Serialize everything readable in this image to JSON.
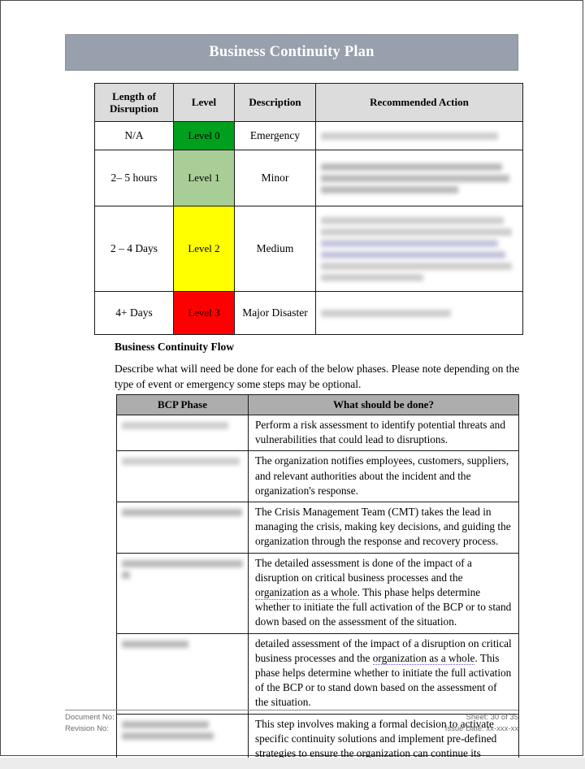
{
  "document": {
    "title": "Business Continuity Plan"
  },
  "severity_table": {
    "headers": [
      "Length of Disruption",
      "Level",
      "Description",
      "Recommended Action"
    ],
    "rows": [
      {
        "length": "N/A",
        "level": "Level 0",
        "level_color": "#00a01e",
        "description": "Emergency",
        "recommended_action": "[redacted]",
        "action_lines": 1
      },
      {
        "length": "2– 5 hours",
        "level": "Level 1",
        "level_color": "#a9cd96",
        "description": "Minor",
        "recommended_action": "[redacted]",
        "action_lines": 3
      },
      {
        "length": "2 – 4 Days",
        "level": "Level 2",
        "level_color": "#ffff00",
        "description": "Medium",
        "recommended_action": "[redacted]",
        "action_lines": 6
      },
      {
        "length": "4+ Days",
        "level": "Level 3",
        "level_color": "#fe0000",
        "description": "Major Disaster",
        "recommended_action": "[redacted]",
        "action_lines": 1
      }
    ]
  },
  "flow_section": {
    "heading": "Business Continuity Flow",
    "paragraph": "Describe what will need be done for each of the below phases. Please note depending on the type of event or emergency some steps may be optional."
  },
  "bcp_table": {
    "headers": [
      "BCP Phase",
      "What should be done?"
    ],
    "rows": [
      {
        "phase": "[redacted]",
        "what_pre": "Perform a risk assessment to identify potential threats and vulnerabilities that could lead to disruptions.",
        "what_spell": "",
        "what_post": ""
      },
      {
        "phase": "[redacted]",
        "what_pre": "The organization notifies employees, customers, suppliers, and relevant authorities about the incident and the organization's response.",
        "what_spell": "",
        "what_post": ""
      },
      {
        "phase": "[redacted]",
        "what_pre": "The Crisis Management Team (CMT) takes the lead in managing the crisis, making key decisions, and guiding the organization through the response and recovery process.",
        "what_spell": "",
        "what_post": ""
      },
      {
        "phase": "[redacted]",
        "what_pre": "The detailed assessment is done of the impact of a disruption on critical business processes and the ",
        "what_spell": "organization as a whole",
        "what_post": ". This phase helps determine whether to initiate the full activation of the BCP or to stand down based on the assessment of the situation."
      },
      {
        "phase": "[redacted]",
        "what_pre": "detailed assessment of the impact of a disruption on critical business processes and the ",
        "what_spell": "organization as a whole",
        "what_post": ". This phase helps determine whether to initiate the full activation of the BCP or to stand down based on the assessment of the situation."
      },
      {
        "phase": "[redacted]",
        "what_pre": "This step involves making a formal decision to activate specific continuity solutions and implement pre-defined strategies to ensure the organization can continue its",
        "what_spell": "",
        "what_post": ""
      }
    ]
  },
  "footer": {
    "document_no_label": "Document No:",
    "revision_no_label": "Revision No:",
    "sheet": "Sheet: 30 of 35",
    "issue_date": "Issue Date: xx-xxx-xx"
  }
}
